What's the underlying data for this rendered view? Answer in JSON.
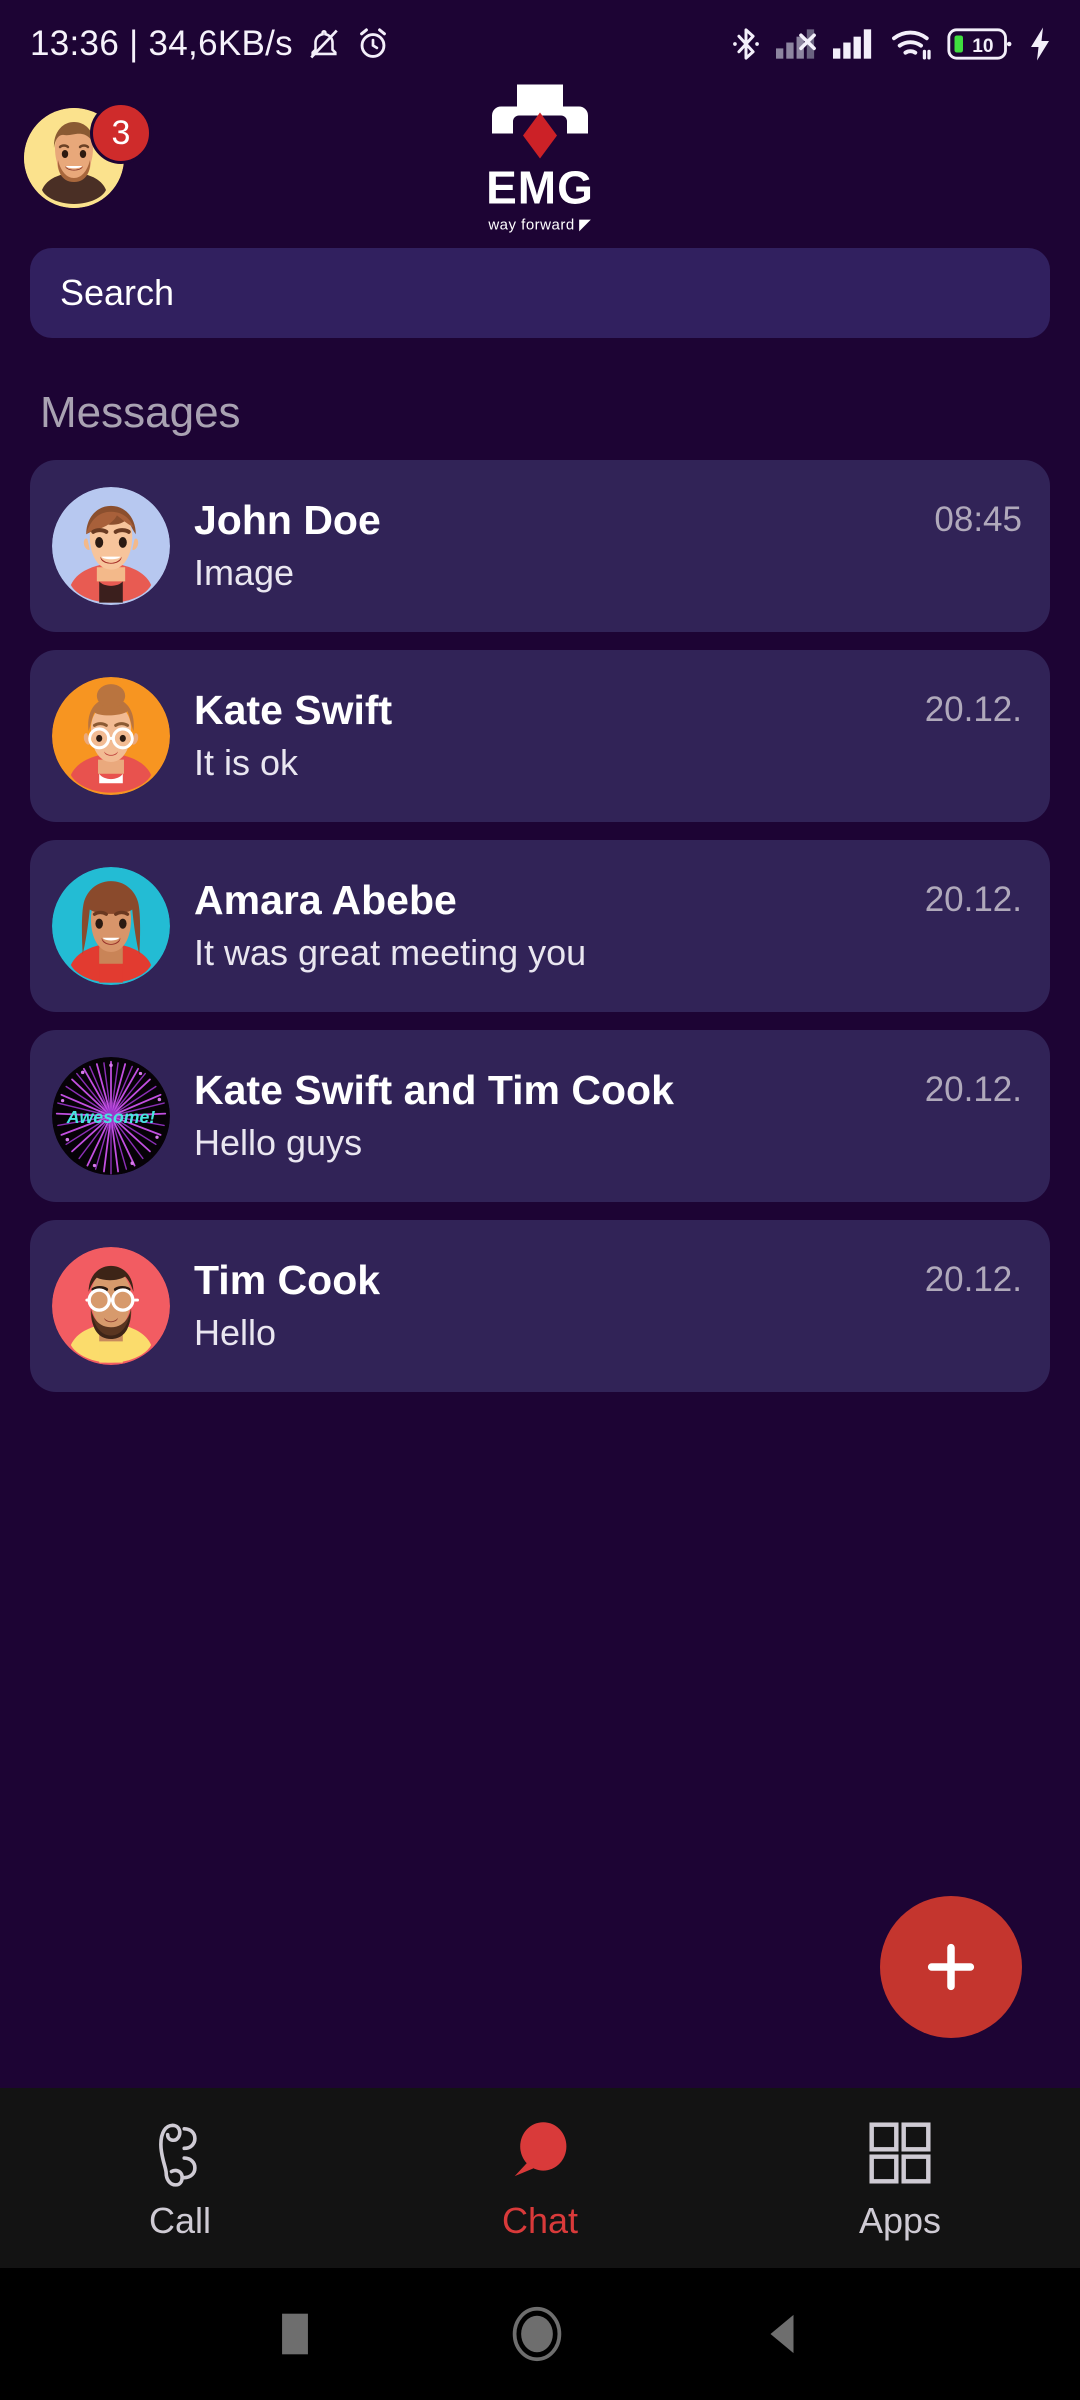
{
  "status_bar": {
    "clock_and_net": "13:36 | 34,6KB/s",
    "left_icons": [
      "bell-mute-icon",
      "alarm-clock-icon"
    ],
    "right_icons": [
      "bluetooth-icon",
      "sim-no-signal-icon",
      "cellular-signal-icon",
      "wifi-icon",
      "battery-icon"
    ],
    "battery_level": "10"
  },
  "header": {
    "profile_avatar": "user-avatar",
    "badge_count": "3",
    "logo_text": "EMG",
    "logo_tagline": "way forward"
  },
  "search": {
    "placeholder": "Search",
    "value": ""
  },
  "section": {
    "title": "Messages"
  },
  "chats": [
    {
      "name": "John Doe",
      "preview": "Image",
      "time": "08:45",
      "avatar": "john-doe-avatar"
    },
    {
      "name": "Kate Swift",
      "preview": "It is ok",
      "time": "20.12.",
      "avatar": "kate-swift-avatar"
    },
    {
      "name": "Amara Abebe",
      "preview": "It was great meeting you",
      "time": "20.12.",
      "avatar": "amara-abebe-avatar"
    },
    {
      "name": "Kate Swift and Tim Cook",
      "preview": "Hello guys",
      "time": "20.12.",
      "avatar": "group-fireworks-avatar"
    },
    {
      "name": "Tim Cook",
      "preview": "Hello",
      "time": "20.12.",
      "avatar": "tim-cook-avatar"
    }
  ],
  "fab": {
    "icon": "plus-icon",
    "label": "New chat"
  },
  "bottom_nav": {
    "items": [
      {
        "label": "Call",
        "icon": "phone-icon",
        "active": false
      },
      {
        "label": "Chat",
        "icon": "speech-bubble-icon",
        "active": true
      },
      {
        "label": "Apps",
        "icon": "grid-icon",
        "active": false
      }
    ]
  },
  "android_nav": {
    "recents": "recents-square-icon",
    "home": "home-circle-icon",
    "back": "back-triangle-icon"
  },
  "colors": {
    "background": "#1d0434",
    "row": "#312357",
    "search": "#31205f",
    "accent_red": "#c4352e",
    "nav_bar": "#131313",
    "muted_text": "#a9a2b2"
  }
}
